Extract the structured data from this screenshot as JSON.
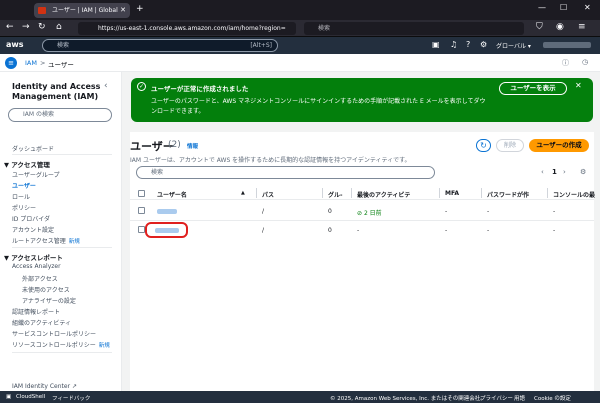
{
  "browser": {
    "tab_title": "ユーザー | IAM | Global",
    "url": "https://us-east-1.console.aws.amazon.com/iam/home?region=",
    "search_placeholder": "検索"
  },
  "aws_header": {
    "logo": "aws",
    "search_placeholder": "検索",
    "search_shortcut": "[Alt+S]",
    "region": "グローバル ▾"
  },
  "breadcrumb": {
    "root": "IAM",
    "separator": ">",
    "current": "ユーザー"
  },
  "sidebar": {
    "title": "Identity and Access Management (IAM)",
    "search_placeholder": "IAM の検索",
    "dashboard": "ダッシュボード",
    "sections": [
      {
        "label": "▼ アクセス管理",
        "items": [
          {
            "label": "ユーザーグループ",
            "new": ""
          },
          {
            "label": "ユーザー",
            "new": ""
          },
          {
            "label": "ロール",
            "new": ""
          },
          {
            "label": "ポリシー",
            "new": ""
          },
          {
            "label": "ID プロバイダ",
            "new": ""
          },
          {
            "label": "アカウント設定",
            "new": ""
          },
          {
            "label": "ルートアクセス管理",
            "new": "新規"
          }
        ]
      },
      {
        "label": "▼ アクセスレポート",
        "items": [
          {
            "label": "Access Analyzer",
            "new": ""
          },
          {
            "label": "外部アクセス",
            "new": ""
          },
          {
            "label": "未使用のアクセス",
            "new": ""
          },
          {
            "label": "アナライザーの設定",
            "new": ""
          },
          {
            "label": "認証情報レポート",
            "new": ""
          },
          {
            "label": "組織のアクティビティ",
            "new": ""
          },
          {
            "label": "サービスコントロールポリシー",
            "new": ""
          },
          {
            "label": "リソースコントロールポリシー",
            "new": "新規"
          }
        ]
      }
    ],
    "bottom_item": "IAM Identity Center ↗"
  },
  "flash": {
    "title": "ユーザーが正常に作成されました",
    "body": "ユーザーのパスワードと、AWS マネジメントコンソールにサインインするための手順が記載された E メールを表示してダウンロードできます。",
    "button": "ユーザーを表示",
    "close": "✕"
  },
  "users": {
    "title": "ユーザー",
    "count": "(2)",
    "info": "情報",
    "description": "IAM ユーザーは、アカウントで AWS を操作するために長期的な認証情報を持つアイデンティティです。",
    "delete_button": "削除",
    "create_button": "ユーザーの作成",
    "search_placeholder": "検索",
    "page": "1",
    "columns": [
      "ユーザー名",
      "パス",
      "グル-",
      "最後のアクティビテ",
      "MFA",
      "パスワードが作",
      "コンソールの最"
    ],
    "rows": [
      {
        "path": "/",
        "groups": "0",
        "last_activity": "2 日前",
        "mfa": "-",
        "password_age": "-",
        "console": "-"
      },
      {
        "path": "/",
        "groups": "0",
        "last_activity": "-",
        "mfa": "-",
        "password_age": "-",
        "console": "-"
      }
    ]
  },
  "footer": {
    "cloudshell": "CloudShell",
    "feedback": "フィードバック",
    "copyright": "© 2025, Amazon Web Services, Inc. またはその関連会社。",
    "privacy": "プライバシー",
    "terms": "用語",
    "cookies": "Cookie の設定"
  },
  "colors": {
    "aws_header": "#232f3e",
    "link": "#0972d3",
    "success": "#037f0c",
    "primary_button": "#ff9900",
    "highlight": "#e0201f"
  }
}
